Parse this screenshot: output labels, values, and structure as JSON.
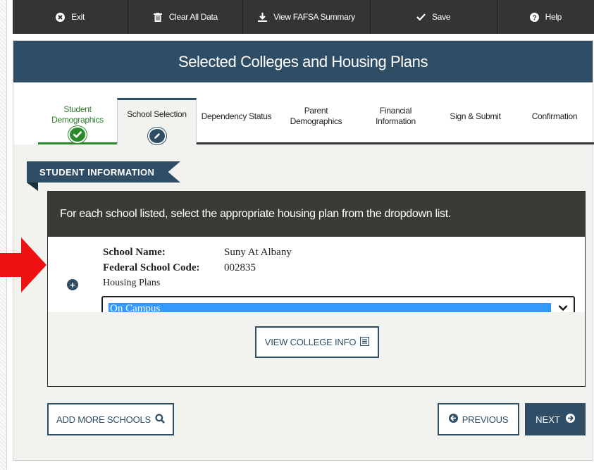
{
  "toolbar": {
    "items": [
      {
        "label": "Exit",
        "icon": "close-circle-icon"
      },
      {
        "label": "Clear All Data",
        "icon": "trash-icon"
      },
      {
        "label": "View FAFSA Summary",
        "icon": "download-icon"
      },
      {
        "label": "Save",
        "icon": "check-icon"
      },
      {
        "label": "Help",
        "icon": "question-circle-icon"
      }
    ]
  },
  "header": {
    "title": "Selected Colleges and Housing Plans"
  },
  "tabs": [
    {
      "line1": "Student",
      "line2": "Demographics",
      "state": "completed"
    },
    {
      "line1": "School Selection",
      "line2": "",
      "state": "active"
    },
    {
      "line1": "Dependency Status",
      "line2": "",
      "state": "pending"
    },
    {
      "line1": "Parent",
      "line2": "Demographics",
      "state": "pending"
    },
    {
      "line1": "Financial",
      "line2": "Information",
      "state": "pending"
    },
    {
      "line1": "Sign & Submit",
      "line2": "",
      "state": "pending"
    },
    {
      "line1": "Confirmation",
      "line2": "",
      "state": "pending"
    }
  ],
  "section": {
    "label": "STUDENT INFORMATION"
  },
  "panel": {
    "instruction": "For each school listed, select the appropriate housing plan from the dropdown list.",
    "school_name_label": "School Name:",
    "school_name": "Suny At Albany",
    "school_code_label": "Federal School Code:",
    "school_code": "002835",
    "housing_label": "Housing Plans",
    "housing_value": "On Campus",
    "view_college_info": "VIEW COLLEGE INFO"
  },
  "footer": {
    "add_more_schools": "ADD MORE SCHOOLS",
    "previous": "PREVIOUS",
    "next": "NEXT"
  },
  "colors": {
    "navy": "#2f4e66",
    "toolbar": "#343434",
    "completed_green": "#2a8a2a",
    "highlight_blue": "#3399ff",
    "annotation_red": "#ee1111"
  }
}
